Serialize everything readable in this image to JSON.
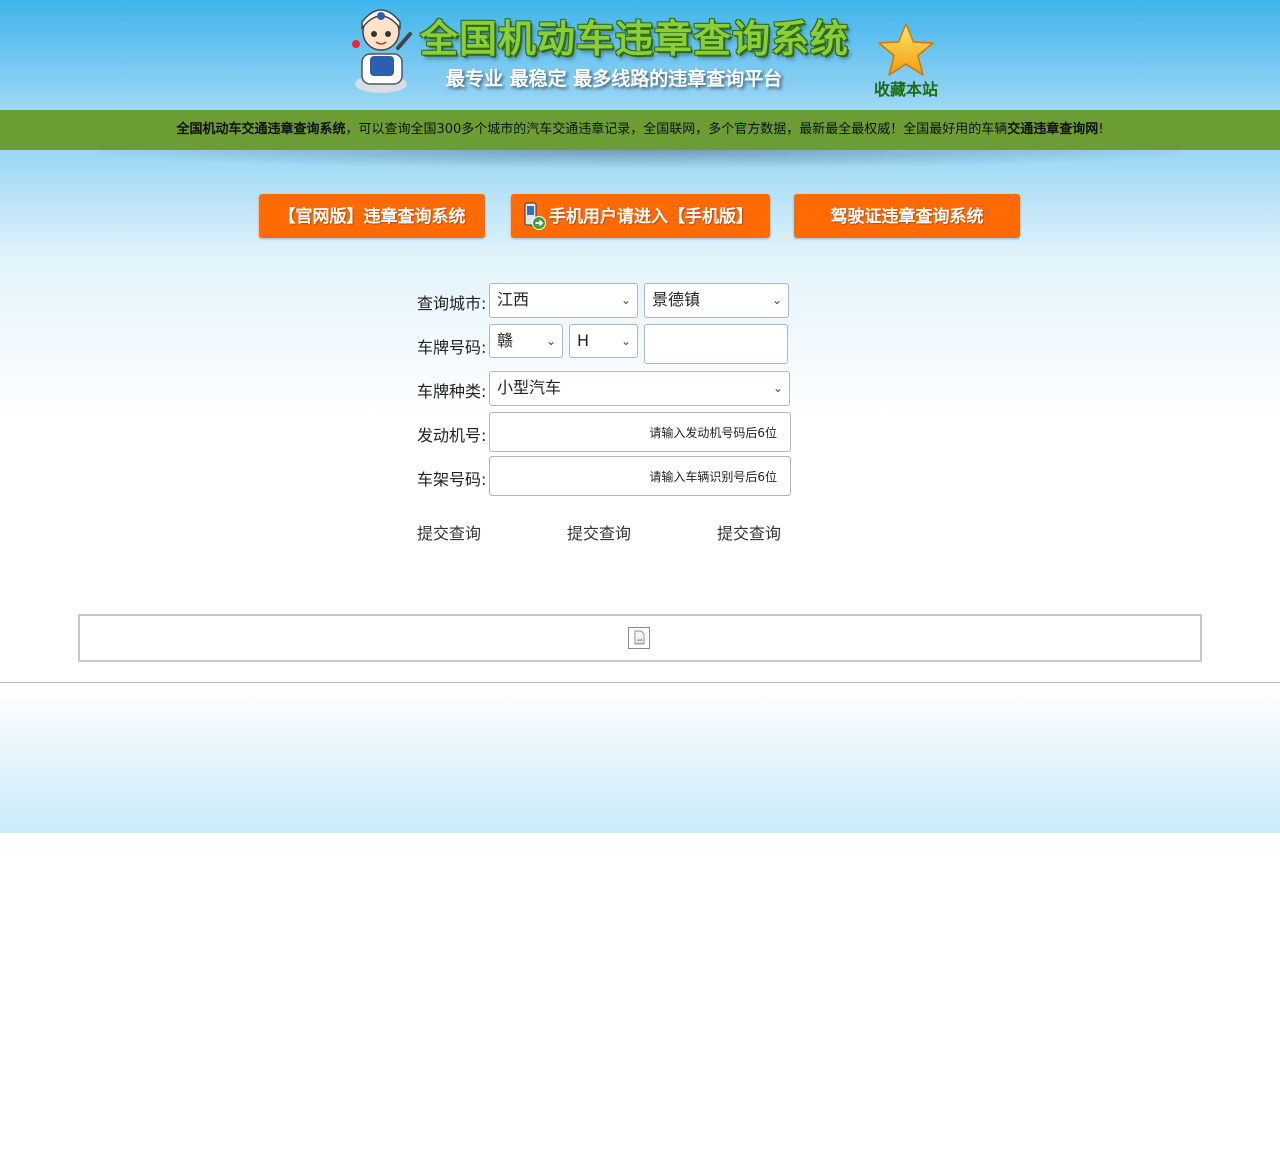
{
  "header": {
    "title": "全国机动车违章查询系统",
    "slogan": "最专业 最稳定 最多线路的违章查询平台",
    "favorite_label": "收藏本站"
  },
  "notice": {
    "part1_bold": "全国机动车交通违章查询系统",
    "part2": "，可以查询全国300多个城市的汽车交通违章记录，全国联网，多个官方数据，最新最全最权威！全国最好用的车辆",
    "part3_bold": "交通违章查询网",
    "part4": "!"
  },
  "nav": {
    "official": "【官网版】违章查询系统",
    "mobile": "手机用户请进入【手机版】",
    "license": "驾驶证违章查询系统"
  },
  "form": {
    "city_label": "查询城市:",
    "province_value": "江西",
    "city_value": "景德镇",
    "plate_label": "车牌号码:",
    "plate_prefix_value": "赣",
    "plate_letter_value": "H",
    "plate_number_value": "",
    "plate_type_label": "车牌种类:",
    "plate_type_value": "小型汽车",
    "engine_label": "发动机号:",
    "engine_hint": "请输入发动机号码后6位",
    "frame_label": "车架号码:",
    "frame_hint": "请输入车辆识别号后6位",
    "submit_labels": [
      "提交查询",
      "提交查询",
      "提交查询"
    ]
  },
  "colors": {
    "header_blue": "#3fb4ec",
    "notice_green": "#6c9d34",
    "button_orange": "#ff6a05",
    "title_green": "#8ccd3a"
  },
  "icons": [
    "mascot-icon",
    "star-icon",
    "phone-icon",
    "broken-image-icon",
    "chevron-down-icon"
  ]
}
